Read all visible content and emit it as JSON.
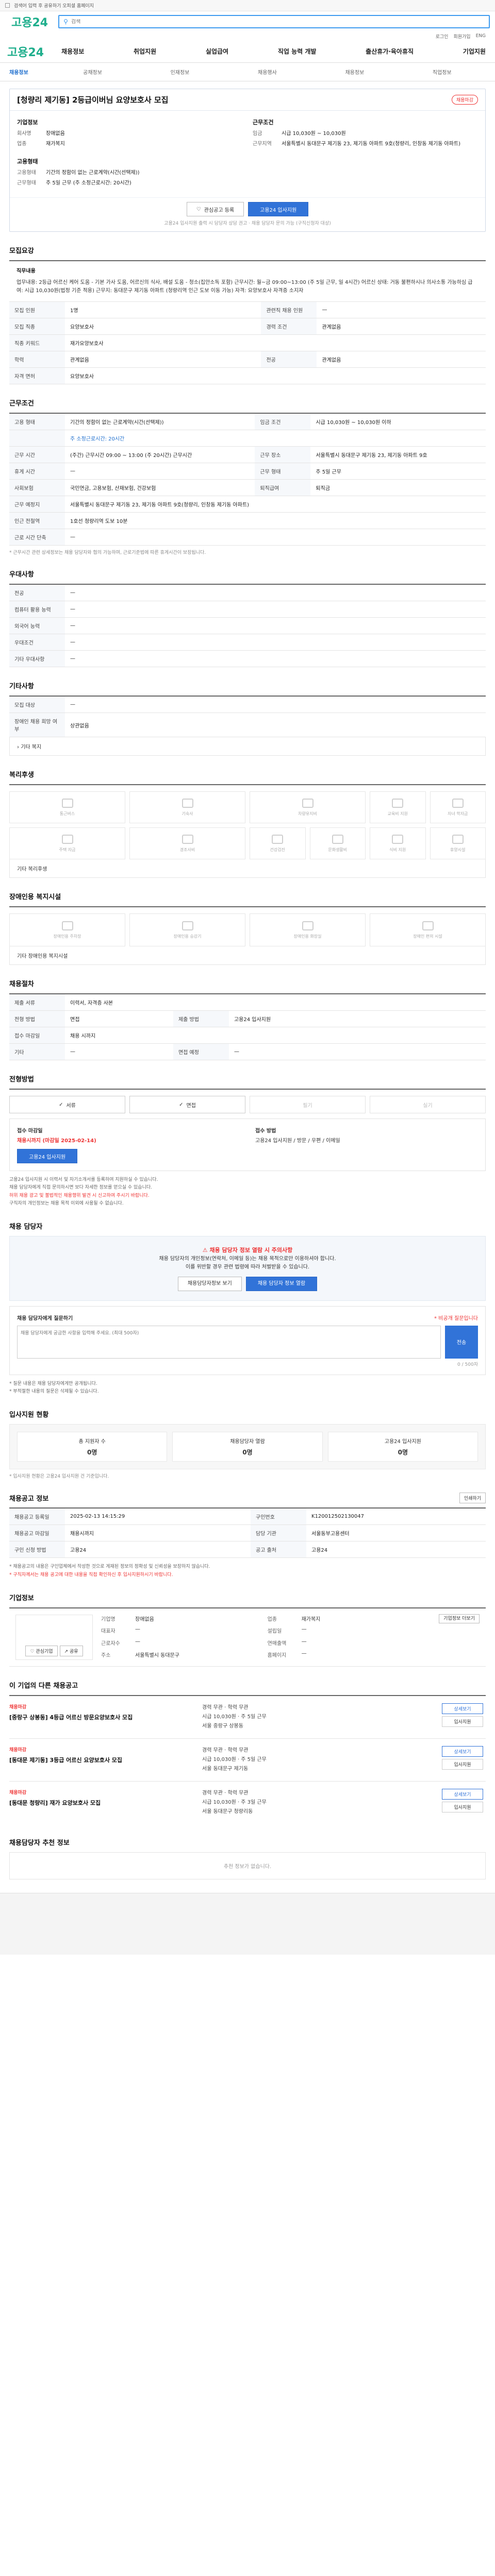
{
  "topbar": {
    "notice": "검색어 입력 후 공유하기 오피셜 홈페이지"
  },
  "site": {
    "logo_main": "고용",
    "logo_sub": "24"
  },
  "search": {
    "placeholder": "검색"
  },
  "util": {
    "login": "로그인",
    "join": "회원가입",
    "lang": "ENG"
  },
  "gnb": {
    "items": [
      "채용정보",
      "취업지원",
      "실업급여",
      "직업 능력 개발",
      "출산휴가·육아휴직",
      "기업지원"
    ]
  },
  "breadcrumb": {
    "home": "채용정보",
    "items": [
      "공채정보",
      "인재정보",
      "채용행사",
      "채용정보",
      "직업정보"
    ]
  },
  "title_card": {
    "title": "[청량리 제기동] 2등급이버님 요양보호사 모집",
    "badge": "채용마감",
    "company_label": "기업정보",
    "company_rows": [
      {
        "k": "회사명",
        "v": "장애없음"
      },
      {
        "k": "업종",
        "v": "재가복지"
      }
    ],
    "conditions_label": "근무조건",
    "condition_rows": [
      {
        "k": "임금",
        "v": "시급 10,030원 ~ 10,030원"
      },
      {
        "k": "근무지역",
        "v": "서울특별시 동대문구 제기동 23, 제기동 아파트 9호(청량리, 인창동 제기동 아파트)"
      }
    ],
    "form_label": "고용형태",
    "form_rows": [
      {
        "k": "고용형태",
        "v": "기간의 정함이 없는 근로계약(시간(선택제))"
      },
      {
        "k": "근무형태",
        "v": "주 5일 근무 (주 소정근로시간: 20시간)"
      }
    ],
    "btn_like": "관심공고 등록",
    "btn_apply": "고용24 입사지원",
    "foot_note": "고용24 입사지원 출력 시 담당자 상담 권고 · 채용 담당자 문의 가능 (구직신청자 대상)"
  },
  "recruit": {
    "title": "모집요강",
    "desc_title": "직무내용",
    "desc": "업무내용: 2등급 어르신 케어 도움 - 기본 가사 도움, 어르신의 식사, 배설 도움 - 청소(집안소독 포함) 근무시간: 월~금 09:00~13:00 (주 5일 근무, 일 4시간) 어르신 상태: 거동 불편하시나 의사소통 가능하심 급여: 시급 10,030원(법정 기준 적용) 근무지: 동대문구 제기동 아파트 (청량리역 인근 도보 이동 가능) 자격: 요양보호사 자격증 소지자",
    "rows": [
      {
        "k": "모집 인원",
        "v": "1명",
        "k2": "관련직 채용 인원",
        "v2": "—"
      },
      {
        "k": "모집 직종",
        "v": "요양보호사",
        "k2": "경력 조건",
        "v2": "관계없음"
      },
      {
        "k": "직종 키워드",
        "v": "재가요양보호사",
        "k2": "",
        "v2": ""
      },
      {
        "k": "학력",
        "v": "관계없음",
        "k2": "전공",
        "v2": "관계없음"
      },
      {
        "k": "자격 면허",
        "v": "요양보호사",
        "k2": "",
        "v2": ""
      }
    ]
  },
  "workcond": {
    "title": "근무조건",
    "rows": [
      {
        "k": "고용 형태",
        "v": "기간의 정함이 없는 근로계약(시간(선택제))",
        "k2": "임금 조건",
        "v2": "시급 10,030원 ~ 10,030원 이하"
      },
      {
        "k": "",
        "v": "주 소정근로시간: 20시간",
        "k2": "",
        "v2": ""
      },
      {
        "k": "근무 시간",
        "v": "(주간) 근무시간 09:00 ~ 13:00 (주 20시간) 근무시간",
        "k2": "근무 장소",
        "v2": "서울특별시 동대문구 제기동 23, 제기동 아파트 9호"
      },
      {
        "k": "휴게 시간",
        "v": "—",
        "k2": "근무 형태",
        "v2": "주 5일 근무"
      },
      {
        "k": "사회보험",
        "v": "국민연금, 고용보험, 산재보험, 건강보험",
        "k2": "퇴직급여",
        "v2": "퇴직금"
      },
      {
        "k": "근무 예정지",
        "v": "서울특별시 동대문구 제기동 23, 제기동 아파트 9호(청량리, 인창동 제기동 아파트)",
        "k2": "",
        "v2": ""
      },
      {
        "k": "인근 전철역",
        "v": "1호선 청량리역 도보 10분",
        "k2": "",
        "v2": ""
      },
      {
        "k": "근로 시간 단축",
        "v": "—",
        "k2": "",
        "v2": ""
      }
    ],
    "note": "* 근무시간 관련 상세정보는 채용 담당자와 협의 가능하며, 근로기준법에 따른 휴게시간이 보장됩니다."
  },
  "prefer": {
    "title": "우대사항",
    "rows": [
      {
        "k": "전공",
        "v": "—"
      },
      {
        "k": "컴퓨터 활용 능력",
        "v": "—"
      },
      {
        "k": "외국어 능력",
        "v": "—"
      },
      {
        "k": "우대조건",
        "v": "—"
      },
      {
        "k": "기타 우대사항",
        "v": "—"
      }
    ]
  },
  "etc": {
    "title": "기타사항",
    "rows": [
      {
        "k": "모집 대상",
        "v": "—"
      },
      {
        "k": "장애인 채용 희망 여부",
        "v": "상관없음"
      }
    ],
    "more": "기타 복지"
  },
  "welfare": {
    "title": "복리후생",
    "items": [
      "통근버스",
      "기숙사",
      "차량유지비",
      "교육비 지원",
      "자녀 학자금",
      "주택 자금",
      "경조사비",
      "건강검진",
      "문화생활비",
      "식비 지원",
      "휴양시설",
      "기타"
    ],
    "more_label": "기타 복리후생"
  },
  "disabled": {
    "title": "장애인용 복지시설",
    "items": [
      "장애인용 주차장",
      "장애인용 승강기",
      "장애인용 화장실",
      "장애인 편의 시설"
    ],
    "more_label": "기타 장애인용 복지시설"
  },
  "hiring": {
    "title": "채용절차",
    "rows": [
      {
        "k": "제출 서류",
        "v": "이력서, 자격증 사본",
        "k2": "",
        "v2": ""
      },
      {
        "k": "전형 방법",
        "v": "면접",
        "k2": "제출 방법",
        "v2": "고용24 입사지원"
      },
      {
        "k": "접수 마감일",
        "v": "채용 시까지",
        "k2": "",
        "v2": ""
      },
      {
        "k": "기타",
        "v": "—",
        "k2": "면접 예정",
        "v2": "—"
      }
    ]
  },
  "apply": {
    "title": "전형방법",
    "methods": [
      "서류",
      "면접",
      "필기",
      "실기"
    ],
    "info_left_title": "접수 마감일",
    "info_left_value": "채용시까지 (마감일 2025-02-14)",
    "info_right_title": "접수 방법",
    "info_right_value": "고용24 입사지원 / 방문 / 우편 / 이메일",
    "apply_btn": "고용24 입사지원",
    "bullets": [
      "고용24 입사지원 시 이력서 및 자기소개서를 등록하여 지원하실 수 있습니다.",
      "채용 담당자에게 직접 문의하시면 보다 자세한 정보를 얻으실 수 있습니다.",
      "허위 채용 광고 및 불법적인 채용행위 발견 시 신고하여 주시기 바랍니다.",
      "구직자의 개인정보는 채용 목적 이외에 사용될 수 없습니다."
    ]
  },
  "manager": {
    "title": "채용 담당자",
    "alert": "채용 담당자 정보 열람 시 주의사항",
    "text1": "채용 담당자의 개인정보(연락처, 이메일 등)는 채용 목적으로만 이용하셔야 합니다.",
    "text2": "이를 위반할 경우 관련 법령에 따라 처벌받을 수 있습니다.",
    "btn_view": "채용담당자정보 보기",
    "btn_contact": "채용 담당자 정보 열람",
    "ask_title": "채용 담당자에게 질문하기",
    "ask_hint": "* 비공개 질문입니다",
    "ask_placeholder": "채용 담당자에게 궁금한 사항을 입력해 주세요. (최대 500자)",
    "ask_count": "0 / 500자",
    "ask_btn": "전송",
    "notes": [
      "* 질문 내용은 채용 담당자에게만 공개됩니다.",
      "* 부적절한 내용의 질문은 삭제될 수 있습니다."
    ]
  },
  "status": {
    "title": "입사지원 현황",
    "items": [
      {
        "label": "총 지원자 수",
        "value": "0명"
      },
      {
        "label": "채용담당자 열람",
        "value": "0명"
      },
      {
        "label": "고용24 입사지원",
        "value": "0명"
      }
    ],
    "note": "* 입사지원 현황은 고용24 입사지원 건 기준입니다."
  },
  "jobinfo": {
    "title": "채용공고 정보",
    "btn": "인쇄하기",
    "rows": [
      {
        "k": "채용공고 등록일",
        "v": "2025-02-13 14:15:29",
        "k2": "구인번호",
        "v2": "K120012502130047"
      },
      {
        "k": "채용공고 마감일",
        "v": "채용시까지",
        "k2": "담당 기관",
        "v2": "서울동부고용센터"
      },
      {
        "k": "구인 신청 방법",
        "v": "고용24",
        "k2": "공고 출처",
        "v2": "고용24"
      }
    ],
    "note1": "* 채용공고의 내용은 구인업체에서 작성한 것으로 게재된 정보의 정확성 및 신뢰성을 보장하지 않습니다.",
    "note2": "* 구직자께서는 채용 공고에 대한 내용을 직접 확인하신 후 입사지원하시기 바랍니다."
  },
  "company": {
    "title": "기업정보",
    "btn_like": "관심기업",
    "btn_share": "공유",
    "rows": [
      {
        "k": "기업명",
        "v": "장애없음",
        "k2": "업종",
        "v2": "재가복지"
      },
      {
        "k": "대표자",
        "v": "—",
        "k2": "설립일",
        "v2": "—"
      },
      {
        "k": "근로자수",
        "v": "—",
        "k2": "연매출액",
        "v2": "—"
      },
      {
        "k": "주소",
        "v": "서울특별시 동대문구",
        "k2": "홈페이지",
        "v2": "—"
      }
    ],
    "more_btn": "기업정보 더보기"
  },
  "others": {
    "title": "이 기업의 다른 채용공고",
    "jobs": [
      {
        "co": "채용마감",
        "title": "[중랑구 상봉동] 4등급 어르신 방문요양보호사 모집",
        "l1": "경력 무관 · 학력 무관",
        "l2": "시급 10,030원 · 주 5일 근무",
        "l3": "서울 중랑구 상봉동"
      },
      {
        "co": "채용마감",
        "title": "[동대문 제기동] 3등급 어르신 요양보호사 모집",
        "l1": "경력 무관 · 학력 무관",
        "l2": "시급 10,030원 · 주 5일 근무",
        "l3": "서울 동대문구 제기동"
      },
      {
        "co": "채용마감",
        "title": "[동대문 청량리] 재가 요양보호사 모집",
        "l1": "경력 무관 · 학력 무관",
        "l2": "시급 10,030원 · 주 3일 근무",
        "l3": "서울 동대문구 청량리동"
      }
    ],
    "btn_view": "상세보기",
    "btn_apply": "입사지원"
  },
  "recommend": {
    "title": "채용담당자 추천 정보",
    "empty": "추천 정보가 없습니다."
  }
}
